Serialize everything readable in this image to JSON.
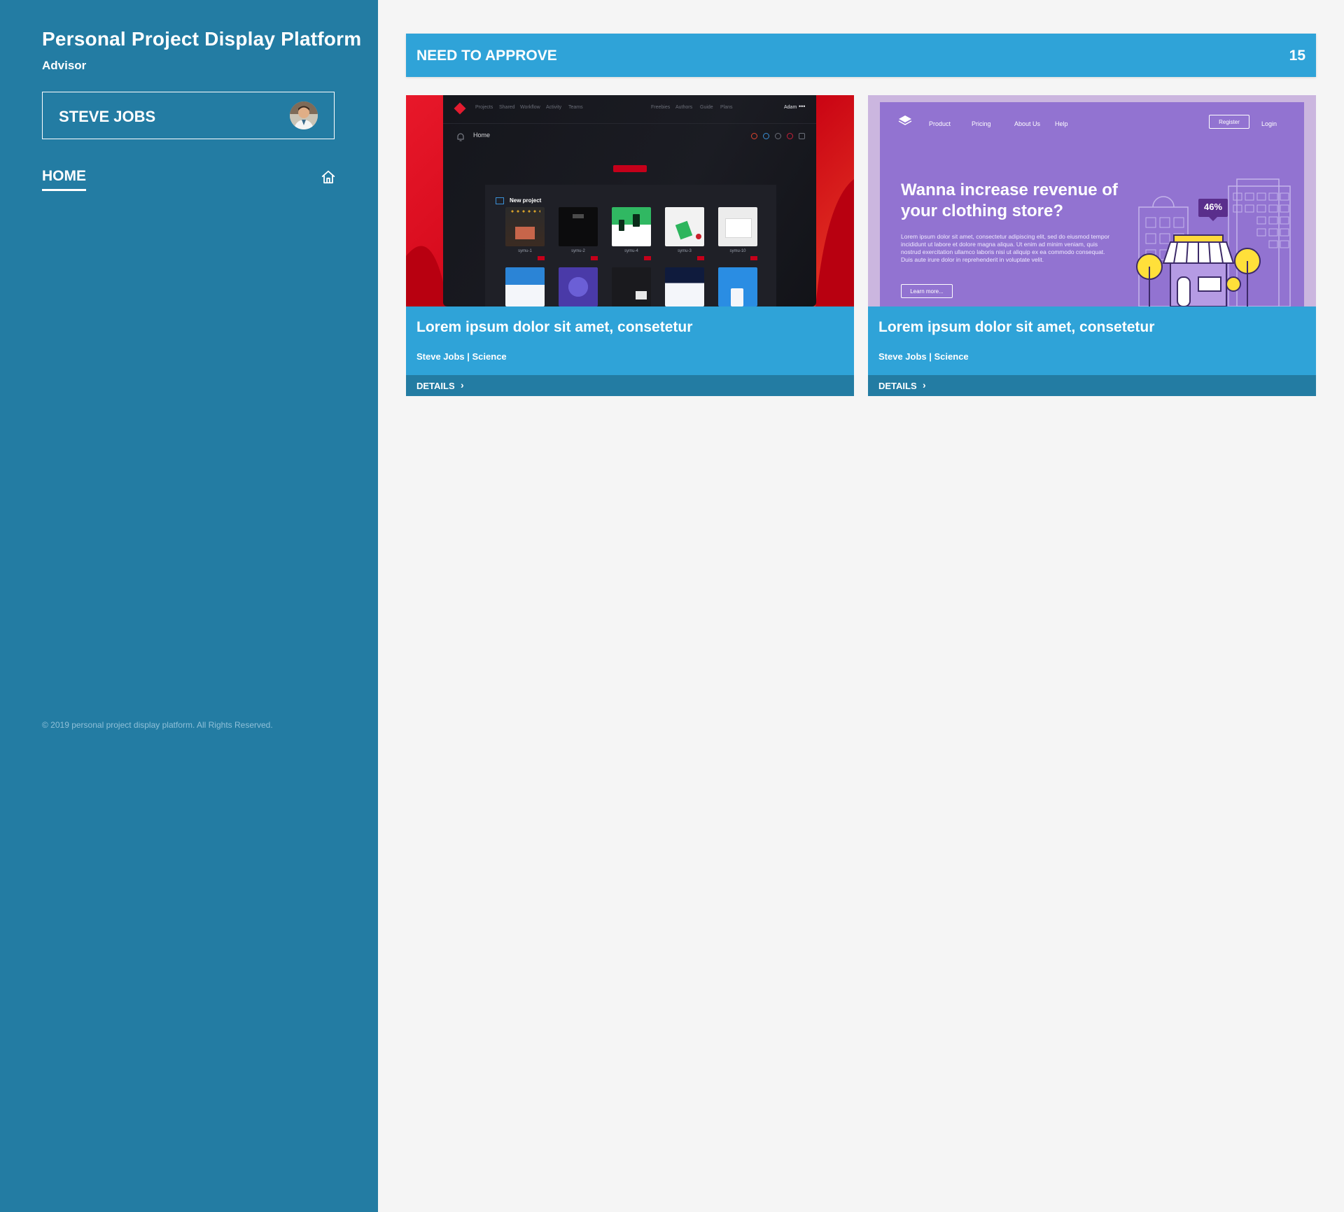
{
  "sidebar": {
    "app_title": "Personal Project Display Platform",
    "role": "Advisor",
    "user_name": "STEVE JOBS",
    "nav_home": "HOME",
    "copyright": "© 2019 personal project display platform. All Rights Reserved."
  },
  "header": {
    "title": "NEED TO APPROVE",
    "count": "15"
  },
  "cards": [
    {
      "title": "Lorem ipsum dolor sit amet, consetetur",
      "meta": "Steve Jobs | Science",
      "details": "DETAILS",
      "thumb": {
        "nav": [
          "Projects",
          "Shared",
          "Workflow",
          "Activity",
          "Teams"
        ],
        "nav_right": [
          "Freebies",
          "Authors",
          "Guide",
          "Plans"
        ],
        "user": "Adam",
        "page": "Home",
        "panel_title": "New project",
        "tiles": [
          "symu-1",
          "symu-2",
          "symu-4",
          "symu-3",
          "symu-10"
        ]
      }
    },
    {
      "title": "Lorem ipsum dolor sit amet, consetetur",
      "meta": "Steve Jobs | Science",
      "details": "DETAILS",
      "thumb": {
        "nav": [
          "Product",
          "Pricing",
          "About Us",
          "Help"
        ],
        "register": "Register",
        "login": "Login",
        "headline": "Wanna increase revenue of your clothing store?",
        "body": "Lorem ipsum dolor sit amet, consectetur adipiscing elit, sed do eiusmod tempor incididunt ut labore et dolore magna aliqua. Ut enim ad minim veniam, quis nostrud exercitation ullamco laboris nisi ut aliquip ex ea commodo consequat. Duis aute irure dolor in reprehenderit in voluptate velit.",
        "button": "Learn more...",
        "badge": "46%"
      }
    }
  ],
  "colors": {
    "sidebar": "#237ca3",
    "accent": "#2fa3d8",
    "background": "#f5f5f5"
  },
  "icons": {
    "nav_home": "home-icon",
    "avatar": "user-avatar"
  }
}
